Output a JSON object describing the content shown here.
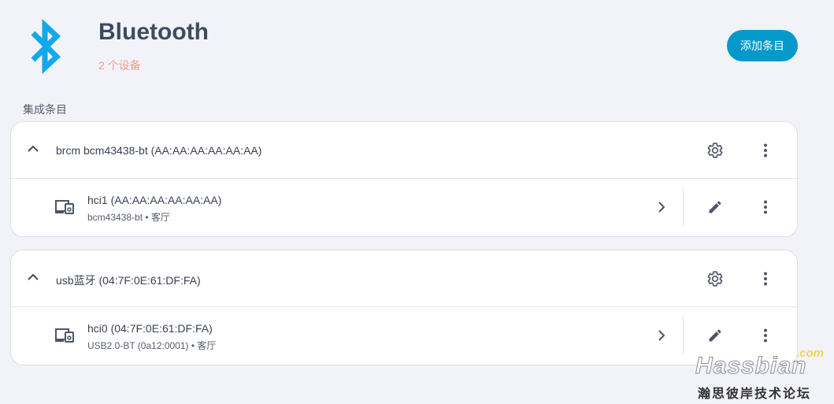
{
  "header": {
    "title": "Bluetooth",
    "subtitle": "2 个设备",
    "add_button": "添加条目",
    "logo_icon": "bluetooth-icon",
    "brand_color": "#039ac9"
  },
  "section_label": "集成条目",
  "entries": [
    {
      "title": "brcm bcm43438-bt (AA:AA:AA:AA:AA:AA)",
      "device": {
        "name": "hci1 (AA:AA:AA:AA:AA:AA)",
        "subtitle": "bcm43438-bt • 客厅"
      }
    },
    {
      "title": "usb蓝牙 (04:7F:0E:61:DF:FA)",
      "device": {
        "name": "hci0 (04:7F:0E:61:DF:FA)",
        "subtitle": "USB2.0-BT (0a12:0001) • 客厅"
      }
    }
  ],
  "watermark": {
    "main": "Hassbian",
    "com": ".com",
    "sub": "瀚思彼岸技术论坛"
  }
}
